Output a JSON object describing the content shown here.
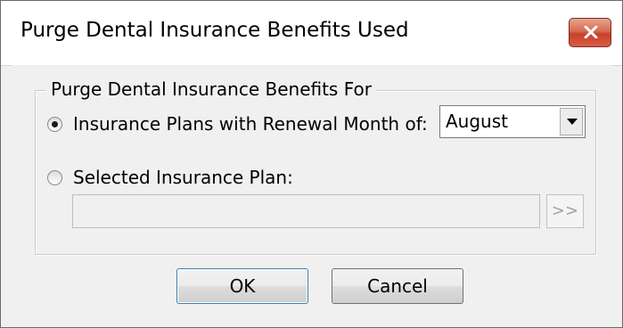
{
  "window": {
    "title": "Purge Dental Insurance Benefits Used",
    "close_icon": "close-icon",
    "close_color": "#c6402a"
  },
  "group": {
    "legend": "Purge Dental Insurance Benefits For",
    "options": [
      {
        "label": "Insurance Plans with Renewal Month of:",
        "checked": true
      },
      {
        "label": "Selected Insurance Plan:",
        "checked": false
      }
    ],
    "renewal_month": {
      "selected": "August",
      "icon": "chevron-down-icon"
    },
    "selected_plan": {
      "value": "",
      "browse_label": ">>"
    }
  },
  "buttons": {
    "ok": "OK",
    "cancel": "Cancel"
  }
}
